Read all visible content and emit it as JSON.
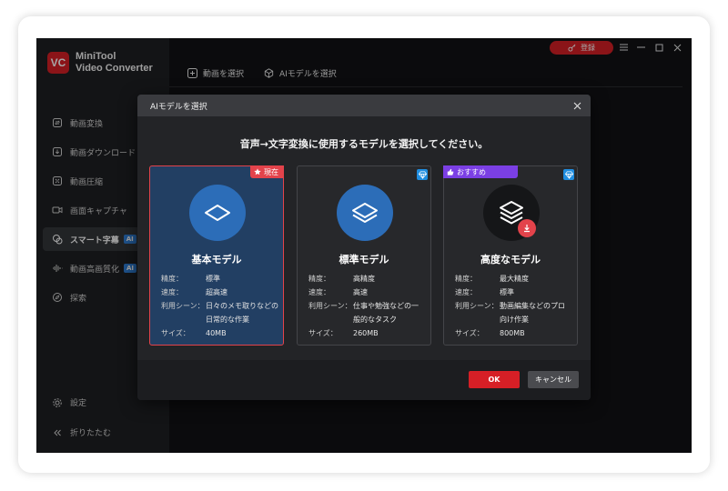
{
  "app": {
    "logo_text": "VC",
    "name_line1": "MiniTool",
    "name_line2": "Video Converter"
  },
  "sidebar": {
    "items": [
      {
        "label": "動画変換",
        "icon": "convert-icon"
      },
      {
        "label": "動画ダウンロード",
        "icon": "download-icon"
      },
      {
        "label": "動画圧縮",
        "icon": "compress-icon"
      },
      {
        "label": "画面キャプチャ",
        "icon": "camera-icon"
      },
      {
        "label": "スマート字幕",
        "icon": "subtitle-icon",
        "tag": "AI"
      },
      {
        "label": "動画高画質化",
        "icon": "waveform-icon",
        "tag": "AI"
      },
      {
        "label": "探索",
        "icon": "compass-icon"
      }
    ],
    "settings_label": "設定",
    "collapse_label": "折りたたむ"
  },
  "topbar": {
    "login_label": "登録"
  },
  "toolbar": {
    "select_video": "動画を選択",
    "select_ai_model": "AIモデルを選択"
  },
  "dialog": {
    "header": "AIモデルを選択",
    "title": "音声→文字変換に使用するモデルを選択してください。",
    "spec_labels": {
      "accuracy": "精度：",
      "speed": "速度：",
      "use": "利用シーン：",
      "size": "サイズ："
    },
    "cards": [
      {
        "name": "基本モデル",
        "badge": "現在",
        "accuracy": "標準",
        "speed": "超高速",
        "use_line1": "日々のメモ取りなどの",
        "use_line2": "日常的な作業",
        "size": "40MB"
      },
      {
        "name": "標準モデル",
        "accuracy": "高精度",
        "speed": "高速",
        "use_line1": "仕事や勉強などの一",
        "use_line2": "般的なタスク",
        "size": "260MB"
      },
      {
        "name": "高度なモデル",
        "badge": "おすすめ",
        "accuracy": "最大精度",
        "speed": "標準",
        "use_line1": "動画編集などのプロ",
        "use_line2": "向け作業",
        "size": "800MB"
      }
    ],
    "ok_label": "OK",
    "cancel_label": "キャンセル"
  },
  "colors": {
    "accent_red": "#d61f26",
    "selected_card": "#223f63",
    "model_blue": "#2c6db8",
    "recommend_purple": "#7b3fe4",
    "ai_tag_blue": "#2f7ed6"
  }
}
